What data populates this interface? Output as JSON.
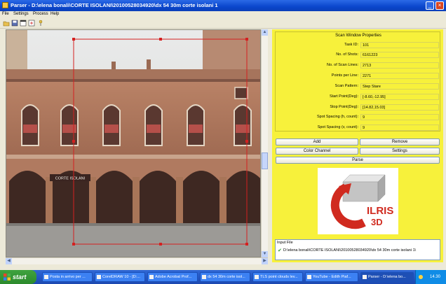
{
  "window": {
    "title": "Parser - D:\\elena bonali\\CORTE ISOLANI\\20100528034920\\dx 54 30m corte isolani 1",
    "minimize_icon": "minimize-icon",
    "close_icon": "close-icon"
  },
  "menu": {
    "file": "File",
    "settings": "Settings",
    "process": "Process",
    "help": "Help"
  },
  "toolbar": {
    "icons": [
      "open-folder-icon",
      "save-icon",
      "window-icon",
      "scan-icon",
      "pin-icon"
    ]
  },
  "scan_properties": {
    "header": "Scan Window Properties",
    "rows": [
      {
        "label": "Task ID:",
        "value": "101"
      },
      {
        "label": "No. of Shots:",
        "value": "6161223"
      },
      {
        "label": "No. of Scan Lines:",
        "value": "2713"
      },
      {
        "label": "Points per Line:",
        "value": "2271"
      },
      {
        "label": "Scan Pattern:",
        "value": "Step Stare"
      },
      {
        "label": "Start Point(Deg):",
        "value": "[-8.60,-12.95]"
      },
      {
        "label": "Stop Point(Deg):",
        "value": "[14.82,15.03]"
      },
      {
        "label": "Spot Spacing (h, count):",
        "value": "9"
      },
      {
        "label": "Spot Spacing (v, count):",
        "value": "9"
      }
    ]
  },
  "buttons": {
    "add": "Add",
    "remove": "Remove",
    "color_channel": "Color Channel",
    "settings": "Settings",
    "parse": "Parse"
  },
  "logo": {
    "text_top": "ILRIS",
    "text_bottom": "3D"
  },
  "input_file": {
    "label": "Input File",
    "path": "D:\\elena bonali\\CORTE ISOLANI\\20100528034920\\dx 54 30m corte isolani 1\\"
  },
  "photo": {
    "sign_text": "CORTE  ISOLANI"
  },
  "taskbar": {
    "start": "start",
    "tasks": [
      "Posta in arrivo per ...",
      "CorelDRAW 10 - [D:...",
      "Adobe Acrobat Prof...",
      "dx 54 30m corte isol...",
      "TLS point clouds lev...",
      "YouTube - Edith Piaf...",
      "Parser - D:\\elena bo..."
    ],
    "clock": "14.30"
  },
  "colors": {
    "panel_bg": "#f7f13b",
    "selection_rect": "#d42020",
    "titlebar": "#0a46cc",
    "taskbar": "#2457c5",
    "logo_red": "#d02a1f"
  }
}
